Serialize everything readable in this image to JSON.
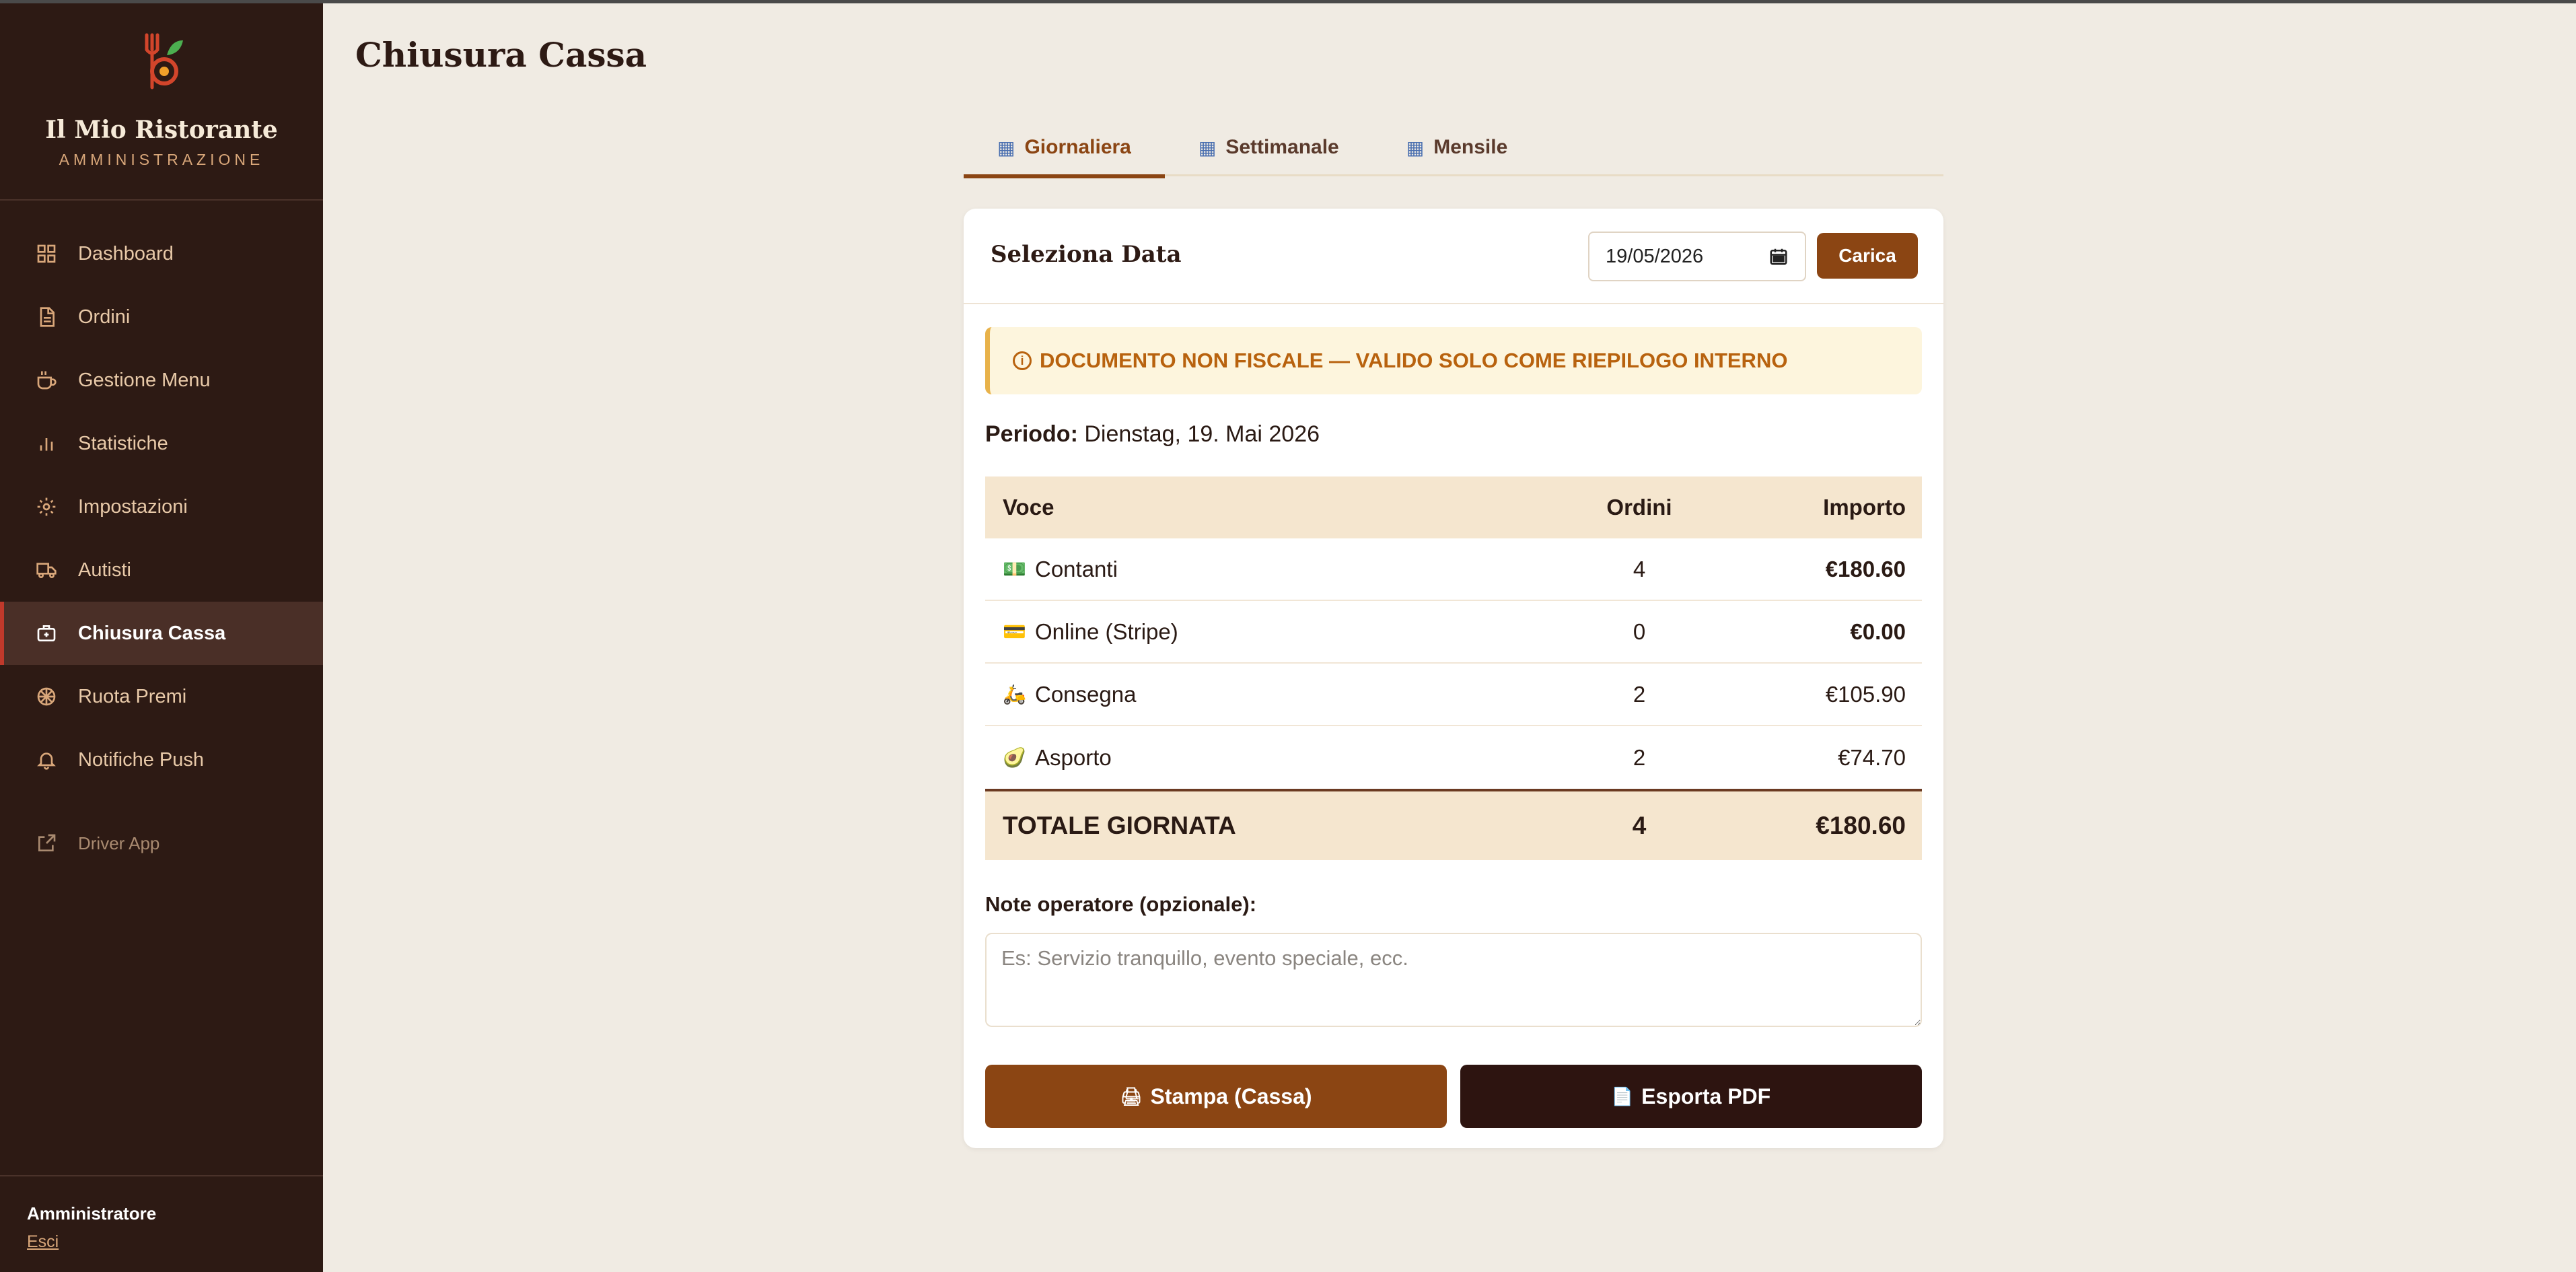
{
  "app": {
    "name": "Il Mio Ristorante",
    "subtitle": "AMMINISTRAZIONE",
    "logo_icon": "restaurant-logo-icon"
  },
  "sidebar": {
    "items": [
      {
        "label": "Dashboard",
        "icon": "grid-icon"
      },
      {
        "label": "Ordini",
        "icon": "document-icon"
      },
      {
        "label": "Gestione Menu",
        "icon": "coffee-cup-icon"
      },
      {
        "label": "Statistiche",
        "icon": "bar-chart-icon"
      },
      {
        "label": "Impostazioni",
        "icon": "gear-icon"
      },
      {
        "label": "Autisti",
        "icon": "truck-icon"
      },
      {
        "label": "Chiusura Cassa",
        "icon": "cash-register-icon",
        "active": true
      },
      {
        "label": "Ruota Premi",
        "icon": "wheel-icon"
      },
      {
        "label": "Notifiche Push",
        "icon": "bell-icon"
      }
    ],
    "external": {
      "label": "Driver App",
      "icon": "external-link-icon"
    },
    "user": {
      "name": "Amministratore",
      "logout": "Esci"
    }
  },
  "page": {
    "title": "Chiusura Cassa"
  },
  "tabs": [
    {
      "label": "Giornaliera",
      "icon": "calendar-icon",
      "active": true
    },
    {
      "label": "Settimanale",
      "icon": "calendar-icon"
    },
    {
      "label": "Mensile",
      "icon": "calendar-icon"
    }
  ],
  "card": {
    "title": "Seleziona Data",
    "date_value": "19/05/2026",
    "load_label": "Carica",
    "alert": "DOCUMENTO NON FISCALE — VALIDO SOLO COME RIEPILOGO INTERNO",
    "period_label": "Periodo:",
    "period_value": "Dienstag, 19. Mai 2026"
  },
  "table": {
    "headers": [
      "Voce",
      "Ordini",
      "Importo"
    ],
    "rows": [
      {
        "emoji": "💵",
        "label": "Contanti",
        "orders": "4",
        "amount": "€180.60"
      },
      {
        "emoji": "💳",
        "label": "Online (Stripe)",
        "orders": "0",
        "amount": "€0.00"
      },
      {
        "emoji": "🛵",
        "label": "Consegna",
        "orders": "2",
        "amount": "€105.90"
      },
      {
        "emoji": "🥑",
        "label": "Asporto",
        "orders": "2",
        "amount": "€74.70"
      }
    ],
    "total": {
      "label": "TOTALE GIORNATA",
      "orders": "4",
      "amount": "€180.60"
    }
  },
  "notes": {
    "label": "Note operatore (opzionale):",
    "placeholder": "Es: Servizio tranquillo, evento speciale, ecc."
  },
  "actions": {
    "print_icon": "🖨",
    "print_label": "Stampa (Cassa)",
    "pdf_icon": "📄",
    "pdf_label": "Esporta PDF"
  },
  "colors": {
    "sidebar_bg": "#2d1a14",
    "accent": "#8b4513",
    "page_bg": "#f0ebe3",
    "active_marker": "#c0392b"
  }
}
